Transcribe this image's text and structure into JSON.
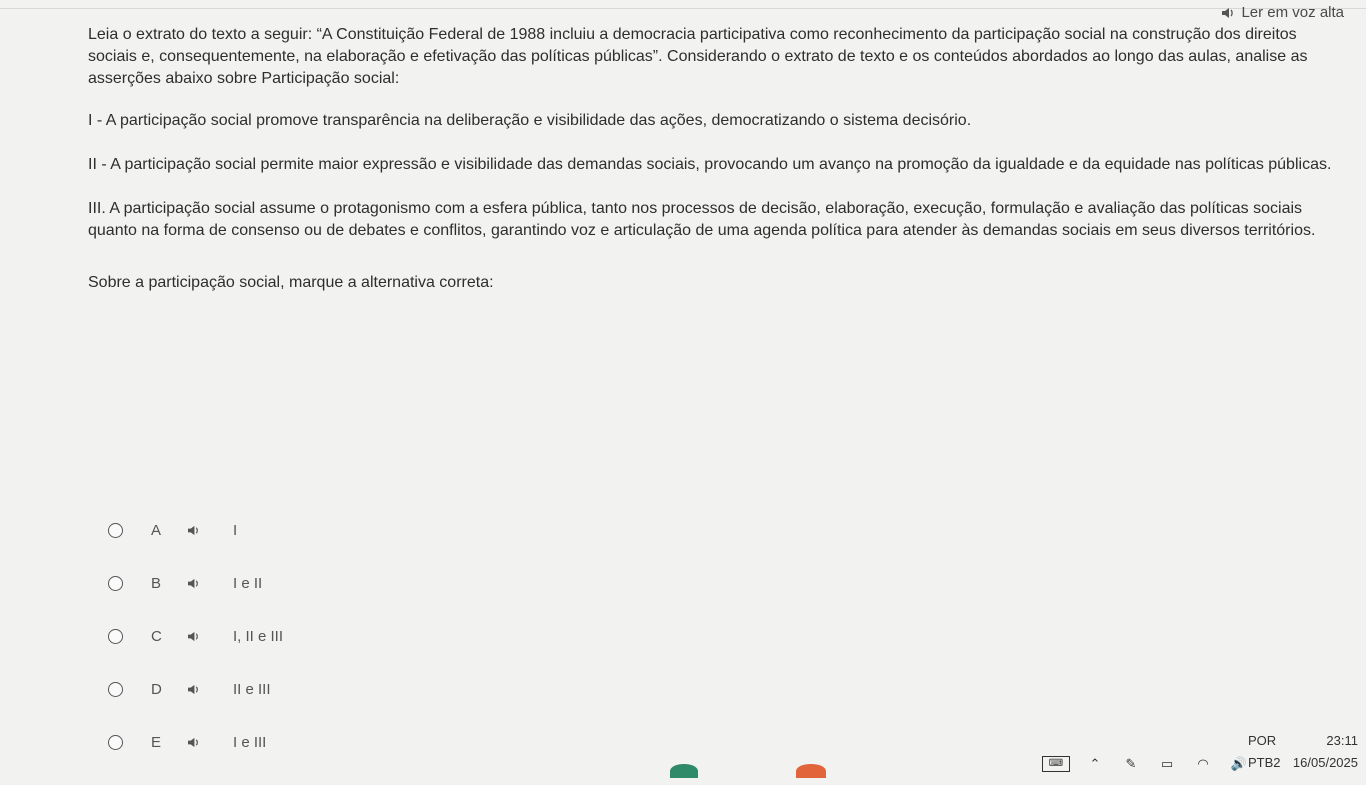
{
  "header": {
    "read_aloud_label": "Ler em voz alta"
  },
  "question": {
    "intro": "Leia o extrato do texto a seguir: “A Constituição Federal de 1988 incluiu a democracia participativa como reconhecimento da participação social na construção dos direitos sociais e, consequentemente, na elaboração e efetivação das políticas públicas”. Considerando o extrato de texto e os conteúdos abordados ao longo das aulas, analise as asserções abaixo sobre Participação social:",
    "assertions": [
      "I - A participação social promove transparência na deliberação e visibilidade das ações, democratizando o sistema decisório.",
      "II - A participação social permite maior expressão e visibilidade das demandas sociais, provocando um avanço na promoção da igualdade e da equidade nas políticas públicas.",
      "III. A participação social assume o protagonismo com a esfera pública, tanto nos processos de decisão, elaboração, execução, formulação e avaliação das políticas sociais quanto na forma de consenso ou de debates e conflitos, garantindo voz e articulação de uma agenda política para atender às demandas sociais em seus diversos territórios."
    ],
    "prompt": "Sobre a participação social, marque a alternativa correta:"
  },
  "options": [
    {
      "letter": "A",
      "text": "I"
    },
    {
      "letter": "B",
      "text": "I e II"
    },
    {
      "letter": "C",
      "text": "I, II e III"
    },
    {
      "letter": "D",
      "text": "II e III"
    },
    {
      "letter": "E",
      "text": "I e III"
    }
  ],
  "taskbar": {
    "language_1": "POR",
    "language_2": "PTB2",
    "time": "23:11",
    "date": "16/05/2025",
    "tray_icons": [
      "chevron-up-icon",
      "pen-icon",
      "battery-icon",
      "wifi-icon",
      "volume-icon"
    ]
  },
  "colors": {
    "background": "#f2f2f0",
    "text": "#2e2e2e",
    "taskbar_green": "#2f8a6a",
    "taskbar_orange": "#e2643a"
  }
}
